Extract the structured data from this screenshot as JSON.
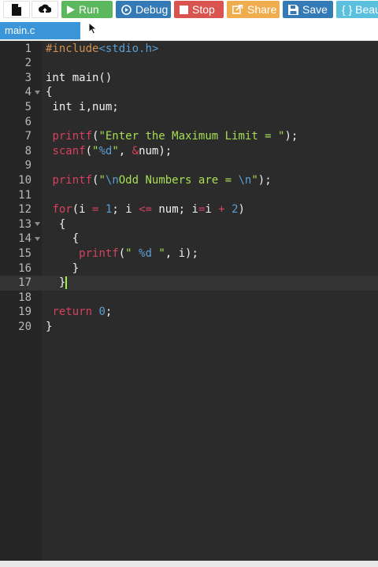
{
  "toolbar": {
    "run_label": "Run",
    "debug_label": "Debug",
    "stop_label": "Stop",
    "share_label": "Share",
    "save_label": "Save",
    "beautify_label": "{ } Beau",
    "icons": {
      "new": "file-icon",
      "upload": "upload-icon",
      "run": "play-icon",
      "debug": "debug-icon",
      "stop": "stop-icon",
      "share": "share-icon",
      "save": "floppy-icon"
    },
    "colors": {
      "run": "#5cb85c",
      "debug": "#337ab7",
      "stop": "#d9534f",
      "share": "#f0ad4e",
      "save": "#337ab7",
      "beautify": "#5bc0de"
    }
  },
  "tabs": [
    {
      "label": "main.c",
      "active": true
    }
  ],
  "editor": {
    "active_line": 17,
    "lines": [
      {
        "n": "1",
        "fold": false,
        "tokens": [
          {
            "t": "#include",
            "c": "directive"
          },
          {
            "t": "<stdio.h>",
            "c": "header"
          }
        ]
      },
      {
        "n": "2",
        "fold": false,
        "tokens": []
      },
      {
        "n": "3",
        "fold": false,
        "tokens": [
          {
            "t": "int main()",
            "c": "plain"
          }
        ]
      },
      {
        "n": "4",
        "fold": true,
        "tokens": [
          {
            "t": "{",
            "c": "plain"
          }
        ]
      },
      {
        "n": "5",
        "fold": false,
        "tokens": [
          {
            "t": " int i,num;",
            "c": "plain"
          }
        ]
      },
      {
        "n": "6",
        "fold": false,
        "tokens": []
      },
      {
        "n": "7",
        "fold": false,
        "tokens": [
          {
            "t": " ",
            "c": "plain"
          },
          {
            "t": "printf",
            "c": "func"
          },
          {
            "t": "(",
            "c": "plain"
          },
          {
            "t": "\"Enter the Maximum Limit = \"",
            "c": "string"
          },
          {
            "t": ");",
            "c": "plain"
          }
        ]
      },
      {
        "n": "8",
        "fold": false,
        "tokens": [
          {
            "t": " ",
            "c": "plain"
          },
          {
            "t": "scanf",
            "c": "func"
          },
          {
            "t": "(",
            "c": "plain"
          },
          {
            "t": "\"",
            "c": "string"
          },
          {
            "t": "%d",
            "c": "format"
          },
          {
            "t": "\"",
            "c": "string"
          },
          {
            "t": ", ",
            "c": "plain"
          },
          {
            "t": "&",
            "c": "op"
          },
          {
            "t": "num);",
            "c": "plain"
          }
        ]
      },
      {
        "n": "9",
        "fold": false,
        "tokens": []
      },
      {
        "n": "10",
        "fold": false,
        "tokens": [
          {
            "t": " ",
            "c": "plain"
          },
          {
            "t": "printf",
            "c": "func"
          },
          {
            "t": "(",
            "c": "plain"
          },
          {
            "t": "\"",
            "c": "string"
          },
          {
            "t": "\\n",
            "c": "format"
          },
          {
            "t": "Odd Numbers are = ",
            "c": "string"
          },
          {
            "t": "\\n",
            "c": "format"
          },
          {
            "t": "\"",
            "c": "string"
          },
          {
            "t": ");",
            "c": "plain"
          }
        ]
      },
      {
        "n": "11",
        "fold": false,
        "tokens": []
      },
      {
        "n": "12",
        "fold": false,
        "tokens": [
          {
            "t": " ",
            "c": "plain"
          },
          {
            "t": "for",
            "c": "keyword"
          },
          {
            "t": "(i ",
            "c": "plain"
          },
          {
            "t": "=",
            "c": "op"
          },
          {
            "t": " ",
            "c": "plain"
          },
          {
            "t": "1",
            "c": "number"
          },
          {
            "t": "; i ",
            "c": "plain"
          },
          {
            "t": "<=",
            "c": "op"
          },
          {
            "t": " num; i",
            "c": "plain"
          },
          {
            "t": "=",
            "c": "op"
          },
          {
            "t": "i ",
            "c": "plain"
          },
          {
            "t": "+",
            "c": "op"
          },
          {
            "t": " ",
            "c": "plain"
          },
          {
            "t": "2",
            "c": "number"
          },
          {
            "t": ")",
            "c": "plain"
          }
        ]
      },
      {
        "n": "13",
        "fold": true,
        "tokens": [
          {
            "t": "  {",
            "c": "plain"
          }
        ]
      },
      {
        "n": "14",
        "fold": true,
        "tokens": [
          {
            "t": "    {",
            "c": "plain"
          }
        ]
      },
      {
        "n": "15",
        "fold": false,
        "tokens": [
          {
            "t": "     ",
            "c": "plain"
          },
          {
            "t": "printf",
            "c": "func"
          },
          {
            "t": "(",
            "c": "plain"
          },
          {
            "t": "\" ",
            "c": "string"
          },
          {
            "t": "%d",
            "c": "format"
          },
          {
            "t": " \"",
            "c": "string"
          },
          {
            "t": ", i);",
            "c": "plain"
          }
        ]
      },
      {
        "n": "16",
        "fold": false,
        "tokens": [
          {
            "t": "    }",
            "c": "plain"
          }
        ]
      },
      {
        "n": "17",
        "fold": false,
        "tokens": [
          {
            "t": "  }",
            "c": "plain"
          }
        ]
      },
      {
        "n": "18",
        "fold": false,
        "tokens": []
      },
      {
        "n": "19",
        "fold": false,
        "tokens": [
          {
            "t": " ",
            "c": "plain"
          },
          {
            "t": "return",
            "c": "keyword"
          },
          {
            "t": " ",
            "c": "plain"
          },
          {
            "t": "0",
            "c": "number"
          },
          {
            "t": ";",
            "c": "plain"
          }
        ]
      },
      {
        "n": "20",
        "fold": false,
        "tokens": [
          {
            "t": "}",
            "c": "plain"
          }
        ]
      }
    ]
  }
}
